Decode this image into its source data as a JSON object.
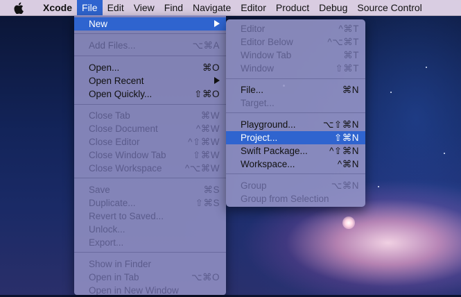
{
  "menubar": {
    "app": "Xcode",
    "items": [
      "File",
      "Edit",
      "View",
      "Find",
      "Navigate",
      "Editor",
      "Product",
      "Debug",
      "Source Control"
    ]
  },
  "file_menu": {
    "new": {
      "label": "New"
    },
    "add_files": {
      "label": "Add Files...",
      "shortcut": "⌥⌘A"
    },
    "open": {
      "label": "Open...",
      "shortcut": "⌘O"
    },
    "open_recent": {
      "label": "Open Recent"
    },
    "open_quickly": {
      "label": "Open Quickly...",
      "shortcut": "⇧⌘O"
    },
    "close_tab": {
      "label": "Close Tab",
      "shortcut": "⌘W"
    },
    "close_document": {
      "label": "Close Document",
      "shortcut": "^⌘W"
    },
    "close_editor": {
      "label": "Close Editor",
      "shortcut": "^⇧⌘W"
    },
    "close_window_tab": {
      "label": "Close Window Tab",
      "shortcut": "⇧⌘W"
    },
    "close_workspace": {
      "label": "Close Workspace",
      "shortcut": "^⌥⌘W"
    },
    "save": {
      "label": "Save",
      "shortcut": "⌘S"
    },
    "duplicate": {
      "label": "Duplicate...",
      "shortcut": "⇧⌘S"
    },
    "revert": {
      "label": "Revert to Saved..."
    },
    "unlock": {
      "label": "Unlock..."
    },
    "export": {
      "label": "Export..."
    },
    "show_in_finder": {
      "label": "Show in Finder"
    },
    "open_in_tab": {
      "label": "Open in Tab",
      "shortcut": "⌥⌘O"
    },
    "open_new_window": {
      "label": "Open in New Window"
    }
  },
  "new_menu": {
    "editor": {
      "label": "Editor",
      "shortcut": "^⌘T"
    },
    "editor_below": {
      "label": "Editor Below",
      "shortcut": "^⌥⌘T"
    },
    "window_tab": {
      "label": "Window Tab",
      "shortcut": "⌘T"
    },
    "window": {
      "label": "Window",
      "shortcut": "⇧⌘T"
    },
    "file": {
      "label": "File...",
      "shortcut": "⌘N"
    },
    "target": {
      "label": "Target..."
    },
    "playground": {
      "label": "Playground...",
      "shortcut": "⌥⇧⌘N"
    },
    "project": {
      "label": "Project...",
      "shortcut": "⇧⌘N"
    },
    "swift_package": {
      "label": "Swift Package...",
      "shortcut": "^⇧⌘N"
    },
    "workspace": {
      "label": "Workspace...",
      "shortcut": "^⌘N"
    },
    "group": {
      "label": "Group",
      "shortcut": "⌥⌘N"
    },
    "group_from_selection": {
      "label": "Group from Selection"
    }
  },
  "colors": {
    "highlight": "#2f64cf",
    "menu_bg": "#9291c4",
    "menubar_bg": "#e2d4e8"
  }
}
